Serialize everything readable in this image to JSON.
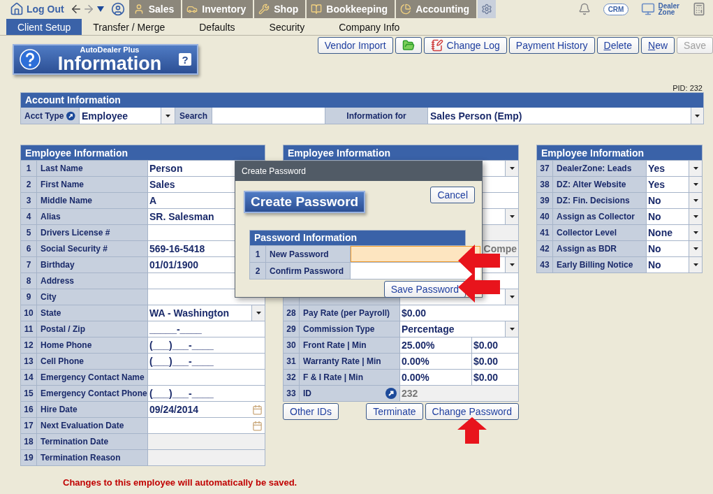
{
  "top_bar": {
    "logout": "Log Out",
    "modules": [
      {
        "label": "Sales",
        "selected": false
      },
      {
        "label": "Inventory",
        "selected": false
      },
      {
        "label": "Shop",
        "selected": false
      },
      {
        "label": "Bookkeeping",
        "selected": false
      },
      {
        "label": "Accounting",
        "selected": false
      }
    ],
    "settings_tab": {
      "selected": true
    },
    "crm_label": "CRM",
    "dealer_zone_lines": [
      "Dealer",
      "Zone"
    ]
  },
  "sub_tabs": [
    {
      "label": "Client Setup",
      "selected": true
    },
    {
      "label": "Transfer / Merge",
      "selected": false
    },
    {
      "label": "Defaults",
      "selected": false
    },
    {
      "label": "Security",
      "selected": false
    },
    {
      "label": "Company Info",
      "selected": false
    }
  ],
  "toolbar": [
    {
      "kind": "text",
      "label": "Vendor Import",
      "disabled": false
    },
    {
      "kind": "folder",
      "disabled": false
    },
    {
      "kind": "log",
      "label": "Change Log",
      "disabled": false
    },
    {
      "kind": "text",
      "label": "Payment History",
      "disabled": false
    },
    {
      "kind": "access",
      "label": "Delete",
      "disabled": false
    },
    {
      "kind": "access",
      "label": "New",
      "disabled": false
    },
    {
      "kind": "text",
      "label": "Save",
      "disabled": true
    }
  ],
  "logo": {
    "subtitle": "AutoDealer Plus",
    "title": "Information",
    "help": "?"
  },
  "pid": "PID: 232",
  "account": {
    "title": "Account Information",
    "acct_type_label": "Acct Type",
    "acct_type": "Employee",
    "search_label": "Search",
    "info_for_label": "Information for",
    "info_for": "Sales Person (Emp)"
  },
  "panels": [
    {
      "title": "Employee Information",
      "rows": [
        {
          "num": "1",
          "label": "Last Name",
          "kind": "text",
          "value": "Person"
        },
        {
          "num": "2",
          "label": "First Name",
          "kind": "text",
          "value": "Sales"
        },
        {
          "num": "3",
          "label": "Middle Name",
          "kind": "text",
          "value": "A"
        },
        {
          "num": "4",
          "label": "Alias",
          "kind": "text",
          "value": "SR. Salesman"
        },
        {
          "num": "5",
          "label": "Drivers License #",
          "kind": "text"
        },
        {
          "num": "6",
          "label": "Social Security #",
          "kind": "text",
          "value": "569-16-5418"
        },
        {
          "num": "7",
          "label": "Birthday",
          "kind": "text",
          "value": "01/01/1900"
        },
        {
          "num": "8",
          "label": "Address",
          "kind": "text"
        },
        {
          "num": "9",
          "label": "City",
          "kind": "text"
        },
        {
          "num": "10",
          "label": "State",
          "kind": "select",
          "value": "WA - Washington"
        },
        {
          "num": "11",
          "label": "Postal / Zip",
          "kind": "text",
          "value": "_____-____"
        },
        {
          "num": "12",
          "label": "Home Phone",
          "kind": "text",
          "value": "(___)___-____"
        },
        {
          "num": "13",
          "label": "Cell Phone",
          "kind": "text",
          "value": "(___)___-____"
        },
        {
          "num": "14",
          "label": "Emergency Contact Name",
          "kind": "text"
        },
        {
          "num": "15",
          "label": "Emergency Contact Phone",
          "kind": "text",
          "value": "(___)___-____"
        },
        {
          "num": "16",
          "label": "Hire Date",
          "kind": "date",
          "value": "09/24/2014"
        },
        {
          "num": "17",
          "label": "Next Evaluation Date",
          "kind": "date"
        },
        {
          "num": "18",
          "label": "Termination Date",
          "kind": "readonly"
        },
        {
          "num": "19",
          "label": "Termination Reason",
          "kind": "readonly"
        }
      ]
    },
    {
      "title": "Employee Information",
      "rows": [
        {
          "kind": "select"
        },
        {
          "kind": "text"
        },
        {
          "kind": "text"
        },
        {
          "kind": "select"
        },
        {
          "kind": "readonly"
        },
        {
          "kind": "covered",
          "value": "Compe"
        },
        {
          "kind": "select"
        },
        {
          "kind": "text"
        },
        {
          "kind": "select"
        },
        {
          "num": "28",
          "label": "Pay Rate (per Payroll)",
          "kind": "text",
          "value": "$0.00"
        },
        {
          "num": "29",
          "label": "Commission Type",
          "kind": "select",
          "value": "Percentage"
        },
        {
          "num": "30",
          "label": "Front Rate | Min",
          "kind": "split",
          "value": "25.00%",
          "value2": "$0.00"
        },
        {
          "num": "31",
          "label": "Warranty Rate | Min",
          "kind": "split",
          "value": "0.00%",
          "value2": "$0.00"
        },
        {
          "num": "32",
          "label": "F & I Rate | Min",
          "kind": "split",
          "value": "0.00%",
          "value2": "$0.00"
        },
        {
          "num": "33",
          "label": "ID",
          "kind": "id",
          "value": "232"
        }
      ],
      "buttons": [
        "Other IDs",
        "Terminate",
        "Change Password"
      ]
    },
    {
      "title": "Employee Information",
      "rows": [
        {
          "num": "37",
          "label": "DealerZone:  Leads",
          "kind": "select",
          "value": "Yes"
        },
        {
          "num": "38",
          "label": "DZ: Alter Website",
          "kind": "select",
          "value": "Yes"
        },
        {
          "num": "39",
          "label": "DZ:  Fin. Decisions",
          "kind": "select",
          "value": "No"
        },
        {
          "num": "40",
          "label": "Assign as Collector",
          "kind": "select",
          "value": "No"
        },
        {
          "num": "41",
          "label": "Collector Level",
          "kind": "select",
          "value": "None"
        },
        {
          "num": "42",
          "label": "Assign as BDR",
          "kind": "select",
          "value": "No"
        },
        {
          "num": "43",
          "label": "Early Billing Notice",
          "kind": "select",
          "value": "No"
        }
      ]
    }
  ],
  "message": "Changes to this employee will automatically be saved.",
  "dialog": {
    "window_title": "Create Password",
    "heading": "Create Password",
    "cancel": "Cancel",
    "section": "Password Information",
    "rows": [
      {
        "num": "1",
        "label": "New Password",
        "focused": true
      },
      {
        "num": "2",
        "label": "Confirm Password",
        "focused": false
      }
    ],
    "save": "Save Password"
  }
}
